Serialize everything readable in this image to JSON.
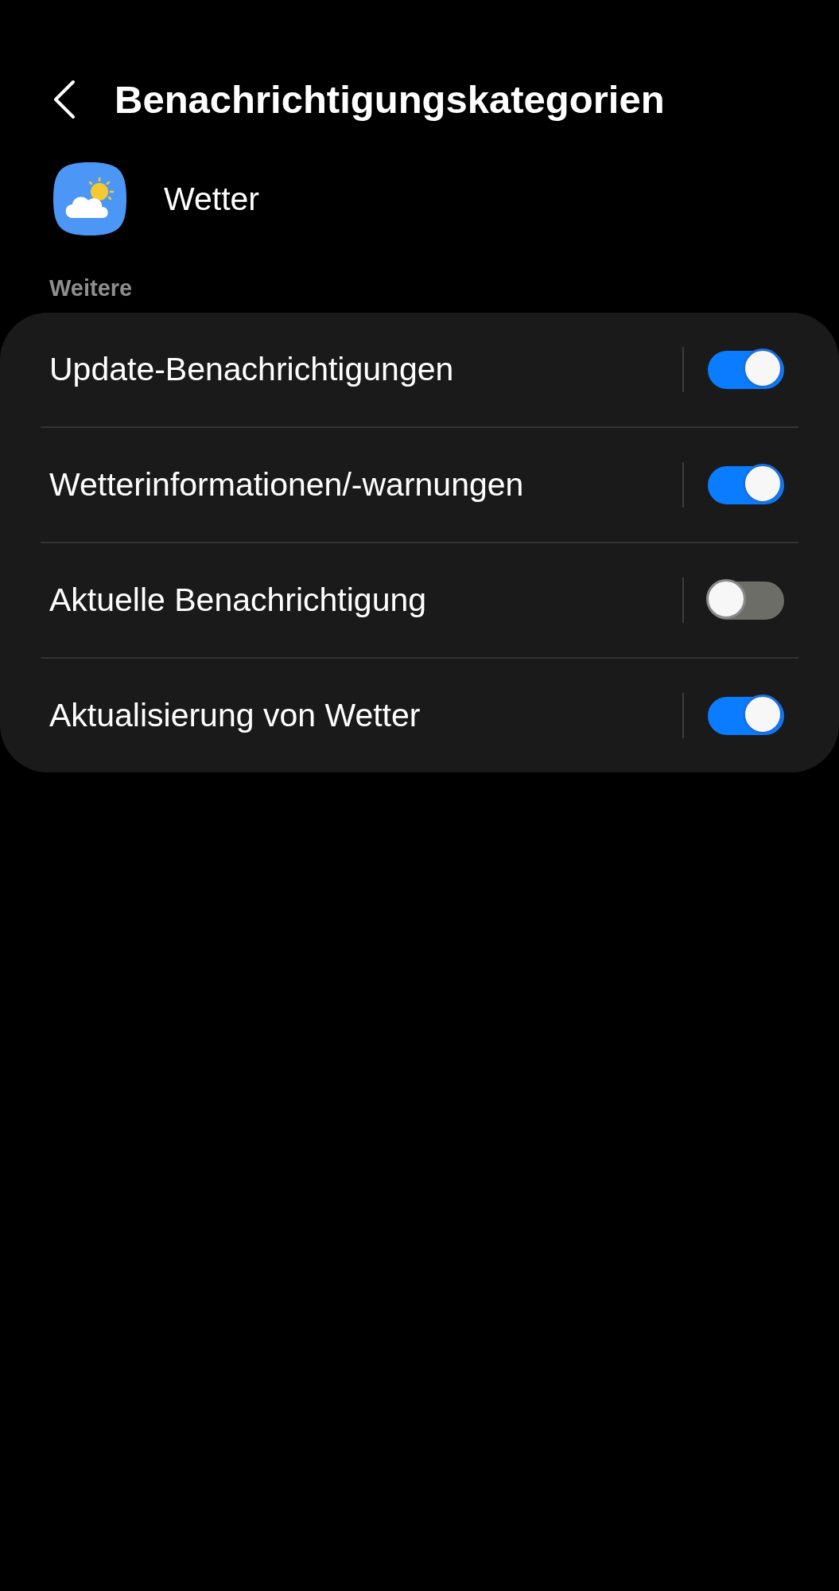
{
  "header": {
    "title": "Benachrichtigungskategorien"
  },
  "app": {
    "name": "Wetter"
  },
  "section": {
    "title": "Weitere"
  },
  "categories": [
    {
      "label": "Update-Benachrichtigungen",
      "on": true
    },
    {
      "label": "Wetterinformationen/-warnungen",
      "on": true
    },
    {
      "label": "Aktuelle Benachrichtigung",
      "on": false
    },
    {
      "label": "Aktualisierung von Wetter",
      "on": true
    }
  ]
}
